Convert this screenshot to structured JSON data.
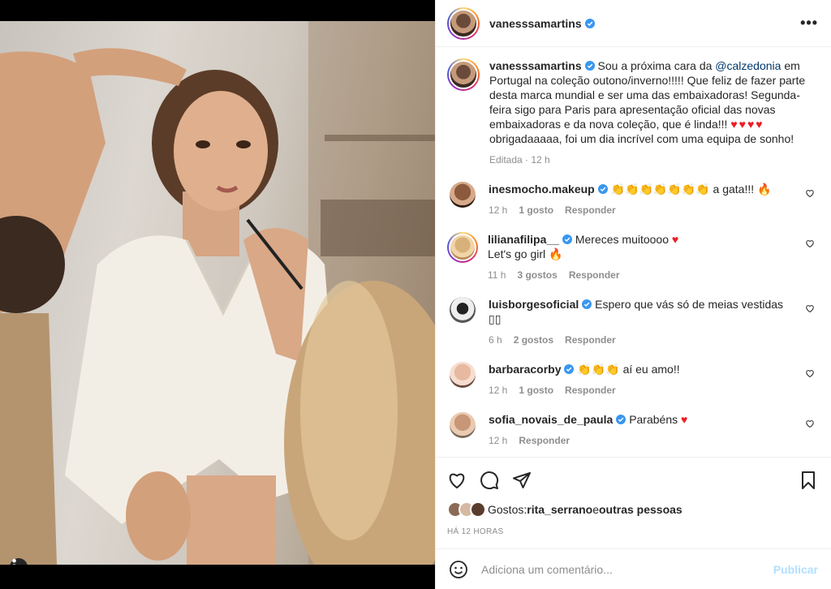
{
  "post": {
    "author": "vanesssamartins",
    "verified_icon": "verified-badge-icon",
    "more_icon": "more-options-icon",
    "more_label": "•••"
  },
  "caption": {
    "author": "vanesssamartins",
    "text_before": "Sou a próxima cara da ",
    "mention": "@calzedonia",
    "text_after": " em Portugal na coleção outono/inverno!!!!! Que feliz de fazer parte desta marca mundial e ser uma das embaixadoras! Segunda-feira sigo para Paris para apresentação oficial das novas embaixadoras e da nova coleção, que é linda!!! ",
    "hearts": "♥♥♥♥",
    "text_end": " obrigadaaaaa, foi um dia incrível com uma equipa de sonho!",
    "meta": "Editada · 12 h"
  },
  "comments": [
    {
      "user": "inesmocho.makeup",
      "text": "a gata!!!",
      "emoji_pre": "👏👏👏👏👏👏👏",
      "emoji_post": "🔥",
      "time": "12 h",
      "likes": "1 gosto",
      "reply": "Responder"
    },
    {
      "user": "lilianafilipa__",
      "text": "Mereces muitoooo",
      "emoji_post": "♥",
      "text2": "Let's go girl",
      "emoji_post2": "🔥",
      "time": "11 h",
      "likes": "3 gostos",
      "reply": "Responder"
    },
    {
      "user": "luisborgesoficial",
      "text": "Espero que vás só de meias vestidas",
      "emoji_post": "▯▯",
      "time": "6 h",
      "likes": "2 gostos",
      "reply": "Responder"
    },
    {
      "user": "barbaracorby",
      "emoji_pre": "👏👏👏",
      "text": "aí eu amo!!",
      "time": "12 h",
      "likes": "1 gosto",
      "reply": "Responder"
    },
    {
      "user": "sofia_novais_de_paula",
      "text": "Parabéns",
      "emoji_post": "♥",
      "time": "12 h",
      "reply": "Responder"
    }
  ],
  "actions": {
    "like_icon": "heart-icon",
    "comment_icon": "comment-icon",
    "share_icon": "share-icon",
    "save_icon": "bookmark-icon"
  },
  "likes": {
    "prefix": "Gostos: ",
    "user": "rita_serrano",
    "middle": " e ",
    "others": "outras pessoas"
  },
  "time_ago": "HÁ 12 HORAS",
  "add_comment": {
    "placeholder": "Adiciona um comentário...",
    "publish": "Publicar",
    "emoji_icon": "smile-icon"
  },
  "colors": {
    "verified": "#3897f0",
    "link": "#00376b",
    "muted": "#8e8e8e",
    "publish_disabled": "#b2dffc",
    "heart": "#ed1b24"
  }
}
